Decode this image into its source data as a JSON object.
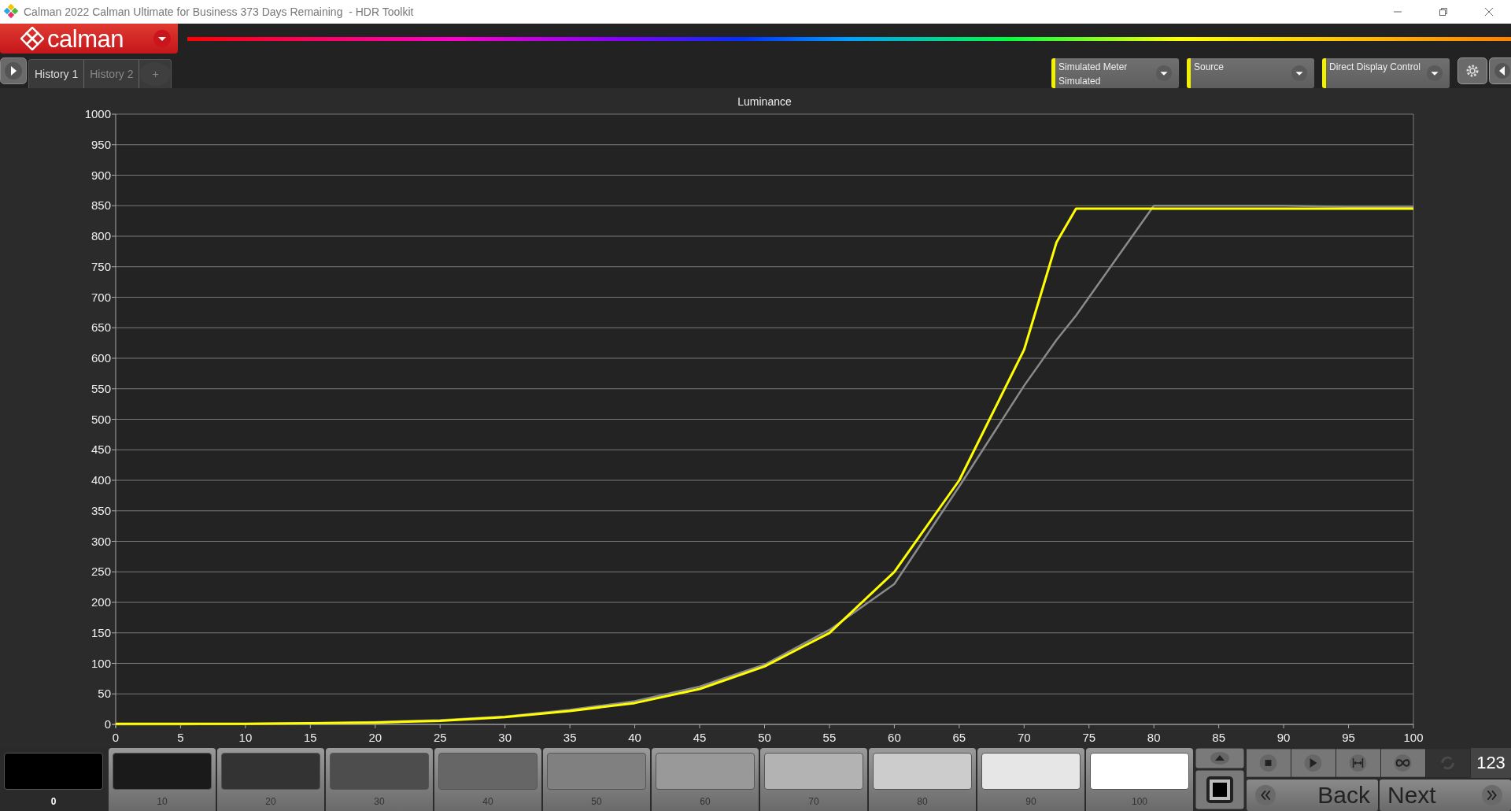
{
  "window": {
    "title": "Calman 2022 Calman Ultimate for Business 373 Days Remaining  - HDR Toolkit"
  },
  "header": {
    "logo": "calman"
  },
  "tabs": [
    {
      "label": "History 1",
      "selected": true
    },
    {
      "label": "History 2",
      "selected": false
    }
  ],
  "add_tab": "+",
  "selectors": [
    {
      "label": "Simulated Meter",
      "value": "Simulated"
    },
    {
      "label": "Source"
    },
    {
      "label": "Direct Display Control"
    }
  ],
  "chart": {
    "chart_data": {
      "type": "line",
      "title": "Luminance",
      "x": [
        0,
        5,
        10,
        15,
        20,
        25,
        30,
        35,
        40,
        45,
        50,
        55,
        60,
        65,
        70,
        72.5,
        74,
        75,
        80,
        85,
        90,
        95,
        100
      ],
      "grid": true,
      "series": [
        {
          "color": "#8a8a8a",
          "values": [
            0,
            0,
            1,
            2,
            4,
            7,
            13,
            24,
            38,
            62,
            98,
            155,
            230,
            390,
            555,
            630,
            670,
            700,
            850,
            850,
            850,
            848,
            848
          ]
        },
        {
          "color": "#ffff00",
          "values": [
            1,
            1,
            1,
            2,
            3,
            6,
            12,
            22,
            35,
            58,
            95,
            150,
            250,
            400,
            614,
            790,
            845,
            845,
            845,
            845,
            845,
            845,
            845
          ]
        }
      ],
      "xlim": [
        0,
        100
      ],
      "ylim": [
        0,
        1000
      ],
      "xticks": [
        0,
        5,
        10,
        15,
        20,
        25,
        30,
        35,
        40,
        45,
        50,
        55,
        60,
        65,
        70,
        75,
        80,
        85,
        90,
        95,
        100
      ],
      "yticks": [
        0,
        50,
        100,
        150,
        200,
        250,
        300,
        350,
        400,
        450,
        500,
        550,
        600,
        650,
        700,
        750,
        800,
        850,
        900,
        950,
        1000
      ]
    }
  },
  "patches": [
    {
      "label": "0",
      "color": "#000000",
      "selected": true
    },
    {
      "label": "10",
      "color": "#1a1a1a",
      "selected": false
    },
    {
      "label": "20",
      "color": "#333333",
      "selected": false
    },
    {
      "label": "30",
      "color": "#4d4d4d",
      "selected": false
    },
    {
      "label": "40",
      "color": "#666666",
      "selected": false
    },
    {
      "label": "50",
      "color": "#808080",
      "selected": false
    },
    {
      "label": "60",
      "color": "#999999",
      "selected": false
    },
    {
      "label": "70",
      "color": "#b3b3b3",
      "selected": false
    },
    {
      "label": "80",
      "color": "#cccccc",
      "selected": false
    },
    {
      "label": "90",
      "color": "#e6e6e6",
      "selected": false
    },
    {
      "label": "100",
      "color": "#ffffff",
      "selected": false
    }
  ],
  "controls": {
    "counter": "123",
    "back": "Back",
    "next": "Next"
  }
}
